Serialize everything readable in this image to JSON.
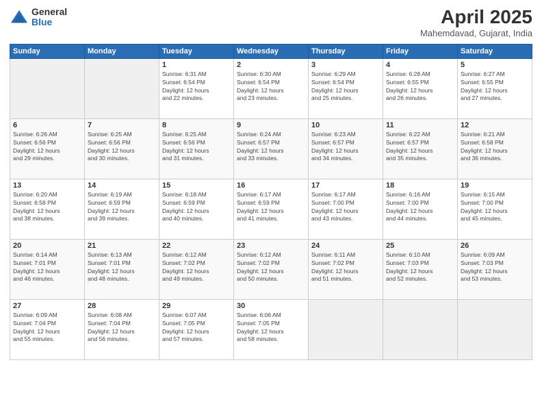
{
  "logo": {
    "general": "General",
    "blue": "Blue"
  },
  "title": "April 2025",
  "subtitle": "Mahemdavad, Gujarat, India",
  "weekdays": [
    "Sunday",
    "Monday",
    "Tuesday",
    "Wednesday",
    "Thursday",
    "Friday",
    "Saturday"
  ],
  "weeks": [
    [
      {
        "day": "",
        "info": ""
      },
      {
        "day": "",
        "info": ""
      },
      {
        "day": "1",
        "info": "Sunrise: 6:31 AM\nSunset: 6:54 PM\nDaylight: 12 hours\nand 22 minutes."
      },
      {
        "day": "2",
        "info": "Sunrise: 6:30 AM\nSunset: 6:54 PM\nDaylight: 12 hours\nand 23 minutes."
      },
      {
        "day": "3",
        "info": "Sunrise: 6:29 AM\nSunset: 6:54 PM\nDaylight: 12 hours\nand 25 minutes."
      },
      {
        "day": "4",
        "info": "Sunrise: 6:28 AM\nSunset: 6:55 PM\nDaylight: 12 hours\nand 26 minutes."
      },
      {
        "day": "5",
        "info": "Sunrise: 6:27 AM\nSunset: 6:55 PM\nDaylight: 12 hours\nand 27 minutes."
      }
    ],
    [
      {
        "day": "6",
        "info": "Sunrise: 6:26 AM\nSunset: 6:56 PM\nDaylight: 12 hours\nand 29 minutes."
      },
      {
        "day": "7",
        "info": "Sunrise: 6:25 AM\nSunset: 6:56 PM\nDaylight: 12 hours\nand 30 minutes."
      },
      {
        "day": "8",
        "info": "Sunrise: 6:25 AM\nSunset: 6:56 PM\nDaylight: 12 hours\nand 31 minutes."
      },
      {
        "day": "9",
        "info": "Sunrise: 6:24 AM\nSunset: 6:57 PM\nDaylight: 12 hours\nand 33 minutes."
      },
      {
        "day": "10",
        "info": "Sunrise: 6:23 AM\nSunset: 6:57 PM\nDaylight: 12 hours\nand 34 minutes."
      },
      {
        "day": "11",
        "info": "Sunrise: 6:22 AM\nSunset: 6:57 PM\nDaylight: 12 hours\nand 35 minutes."
      },
      {
        "day": "12",
        "info": "Sunrise: 6:21 AM\nSunset: 6:58 PM\nDaylight: 12 hours\nand 36 minutes."
      }
    ],
    [
      {
        "day": "13",
        "info": "Sunrise: 6:20 AM\nSunset: 6:58 PM\nDaylight: 12 hours\nand 38 minutes."
      },
      {
        "day": "14",
        "info": "Sunrise: 6:19 AM\nSunset: 6:59 PM\nDaylight: 12 hours\nand 39 minutes."
      },
      {
        "day": "15",
        "info": "Sunrise: 6:18 AM\nSunset: 6:59 PM\nDaylight: 12 hours\nand 40 minutes."
      },
      {
        "day": "16",
        "info": "Sunrise: 6:17 AM\nSunset: 6:59 PM\nDaylight: 12 hours\nand 41 minutes."
      },
      {
        "day": "17",
        "info": "Sunrise: 6:17 AM\nSunset: 7:00 PM\nDaylight: 12 hours\nand 43 minutes."
      },
      {
        "day": "18",
        "info": "Sunrise: 6:16 AM\nSunset: 7:00 PM\nDaylight: 12 hours\nand 44 minutes."
      },
      {
        "day": "19",
        "info": "Sunrise: 6:15 AM\nSunset: 7:00 PM\nDaylight: 12 hours\nand 45 minutes."
      }
    ],
    [
      {
        "day": "20",
        "info": "Sunrise: 6:14 AM\nSunset: 7:01 PM\nDaylight: 12 hours\nand 46 minutes."
      },
      {
        "day": "21",
        "info": "Sunrise: 6:13 AM\nSunset: 7:01 PM\nDaylight: 12 hours\nand 48 minutes."
      },
      {
        "day": "22",
        "info": "Sunrise: 6:12 AM\nSunset: 7:02 PM\nDaylight: 12 hours\nand 49 minutes."
      },
      {
        "day": "23",
        "info": "Sunrise: 6:12 AM\nSunset: 7:02 PM\nDaylight: 12 hours\nand 50 minutes."
      },
      {
        "day": "24",
        "info": "Sunrise: 6:11 AM\nSunset: 7:02 PM\nDaylight: 12 hours\nand 51 minutes."
      },
      {
        "day": "25",
        "info": "Sunrise: 6:10 AM\nSunset: 7:03 PM\nDaylight: 12 hours\nand 52 minutes."
      },
      {
        "day": "26",
        "info": "Sunrise: 6:09 AM\nSunset: 7:03 PM\nDaylight: 12 hours\nand 53 minutes."
      }
    ],
    [
      {
        "day": "27",
        "info": "Sunrise: 6:09 AM\nSunset: 7:04 PM\nDaylight: 12 hours\nand 55 minutes."
      },
      {
        "day": "28",
        "info": "Sunrise: 6:08 AM\nSunset: 7:04 PM\nDaylight: 12 hours\nand 56 minutes."
      },
      {
        "day": "29",
        "info": "Sunrise: 6:07 AM\nSunset: 7:05 PM\nDaylight: 12 hours\nand 57 minutes."
      },
      {
        "day": "30",
        "info": "Sunrise: 6:06 AM\nSunset: 7:05 PM\nDaylight: 12 hours\nand 58 minutes."
      },
      {
        "day": "",
        "info": ""
      },
      {
        "day": "",
        "info": ""
      },
      {
        "day": "",
        "info": ""
      }
    ]
  ]
}
